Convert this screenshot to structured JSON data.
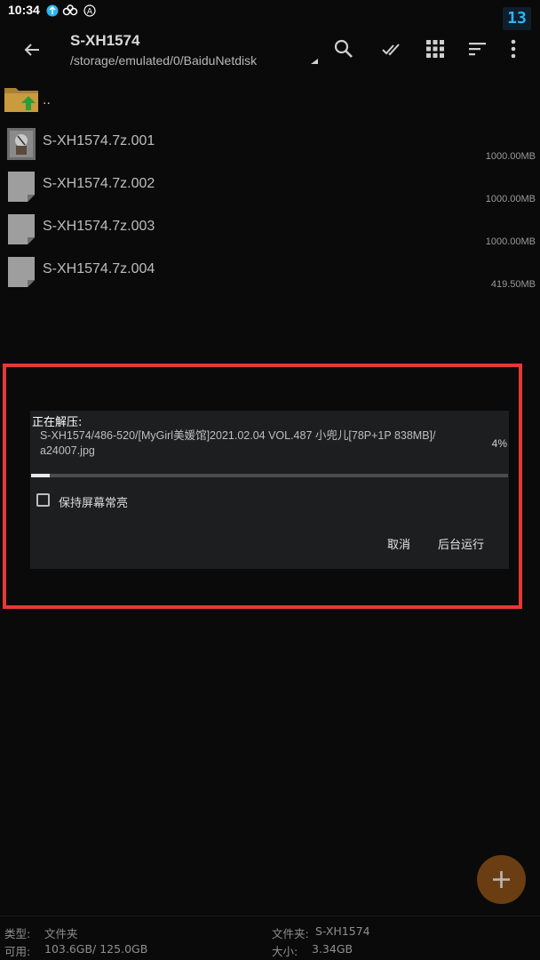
{
  "status": {
    "time": "10:34",
    "badge": "13",
    "icons": [
      "sync-icon",
      "cloud-icon",
      "a11y-icon"
    ]
  },
  "toolbar": {
    "title": "S-XH1574",
    "path": "/storage/emulated/0/BaiduNetdisk",
    "icons": [
      "back-arrow-icon",
      "search-icon",
      "select-all-icon",
      "grid-view-icon",
      "sort-icon",
      "more-vert-icon"
    ]
  },
  "files": [
    {
      "name": "..",
      "size": "",
      "thumb": "parent-folder-icon"
    },
    {
      "name": "S-XH1574.7z.001",
      "size": "1000.00MB",
      "thumb": "archive-thumb-icon"
    },
    {
      "name": "S-XH1574.7z.002",
      "size": "1000.00MB",
      "thumb": "file-icon"
    },
    {
      "name": "S-XH1574.7z.003",
      "size": "1000.00MB",
      "thumb": "file-icon"
    },
    {
      "name": "S-XH1574.7z.004",
      "size": "419.50MB",
      "thumb": "file-icon"
    }
  ],
  "dialog": {
    "title": "正在解压:",
    "path_line1": "S-XH1574/486-520/[MyGirl美媛馆]2021.02.04 VOL.487 小兜儿[78P+1P 838MB]/",
    "path_line2": "a24007.jpg",
    "percent_label": "4%",
    "progress": 0.04,
    "keep_screen_on_label": "保持屏幕常亮",
    "keep_screen_on": false,
    "cancel_label": "取消",
    "background_label": "后台运行"
  },
  "fab": {
    "icon": "plus-icon",
    "color": "#6b3d13"
  },
  "footer": {
    "type_label": "类型:",
    "type_value": "文件夹",
    "avail_label": "可用:",
    "avail_value": "103.6GB/ 125.0GB",
    "folder_label": "文件夹:",
    "folder_value": "S-XH1574",
    "size_label": "大小:",
    "size_value": "3.34GB"
  },
  "colors": {
    "highlight": "#e53935",
    "accent": "#29b6f6",
    "background": "#0a0a0a"
  }
}
